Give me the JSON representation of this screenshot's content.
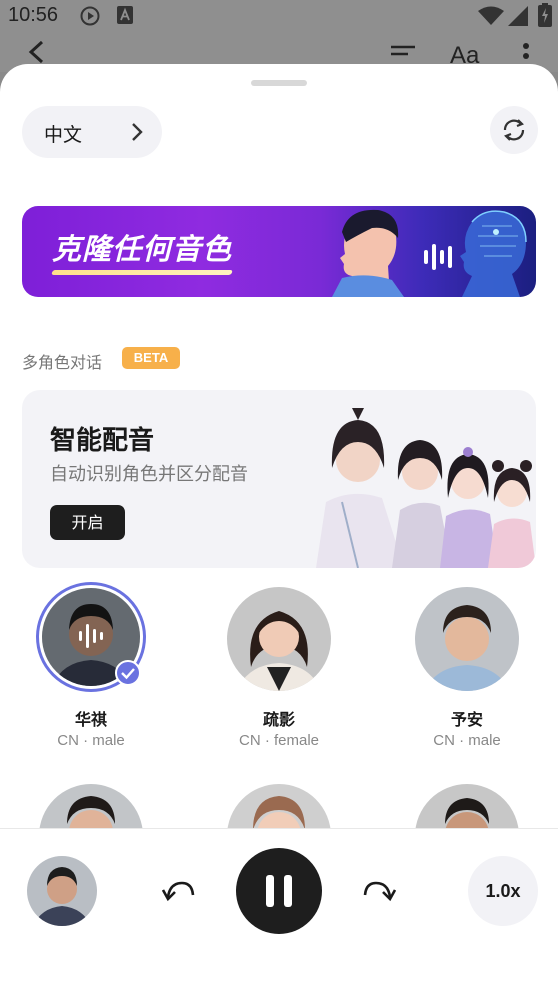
{
  "status_bar": {
    "time": "10:56",
    "icons": [
      "play-circle-icon",
      "text-a-icon",
      "wifi-icon",
      "signal-icon",
      "battery-charging-icon"
    ]
  },
  "app_bar": {
    "icons": [
      "back-arrow-icon",
      "list-icon",
      "font-size-icon",
      "more-vertical-icon"
    ],
    "font_label": "Aa"
  },
  "sheet": {
    "language": {
      "label": "中文"
    },
    "banner": {
      "title": "克隆任何音色"
    },
    "section": {
      "label": "多角色对话",
      "badge": "BETA"
    },
    "smart_dub": {
      "title": "智能配音",
      "subtitle": "自动识别角色并区分配音",
      "button": "开启"
    },
    "voices": [
      {
        "name": "华祺",
        "meta": "CN · male",
        "selected": true
      },
      {
        "name": "疏影",
        "meta": "CN · female",
        "selected": false
      },
      {
        "name": "予安",
        "meta": "CN · male",
        "selected": false
      }
    ]
  },
  "player": {
    "speed": "1.0x",
    "state": "playing"
  },
  "colors": {
    "accent": "#6a72e0",
    "dark": "#1e1e1e",
    "beta": "#f7b04a"
  }
}
